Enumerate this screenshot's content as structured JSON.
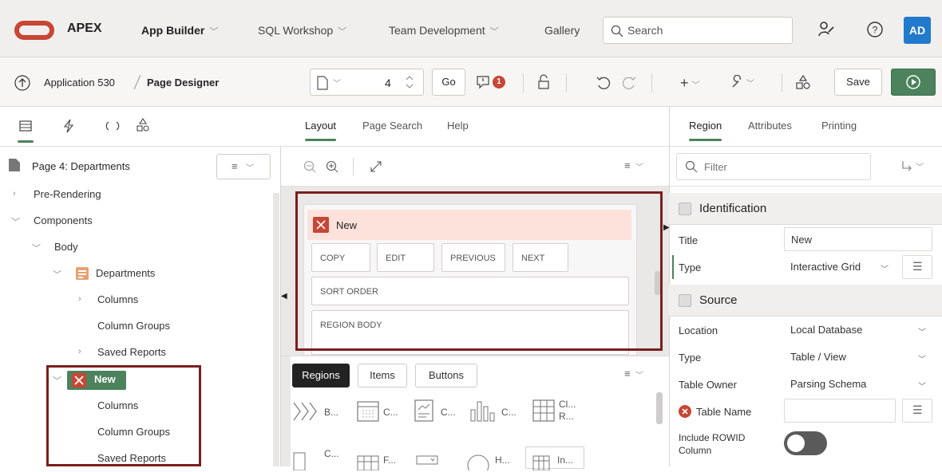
{
  "topnav": {
    "brand": "APEX",
    "items": [
      "App Builder",
      "SQL Workshop",
      "Team Development",
      "Gallery"
    ],
    "search_placeholder": "Search",
    "avatar": "AD"
  },
  "toolbar": {
    "breadcrumb_app": "Application 530",
    "breadcrumb_page": "Page Designer",
    "page_number": "4",
    "go_label": "Go",
    "issues_count": "1",
    "save_label": "Save"
  },
  "left": {
    "page_title": "Page 4: Departments",
    "tree": {
      "pre_rendering": "Pre-Rendering",
      "components": "Components",
      "body": "Body",
      "departments": "Departments",
      "columns": "Columns",
      "column_groups": "Column Groups",
      "saved_reports": "Saved Reports",
      "new": "New",
      "new_columns": "Columns",
      "new_column_groups": "Column Groups",
      "new_saved_reports": "Saved Reports"
    }
  },
  "middle": {
    "tabs": [
      "Layout",
      "Page Search",
      "Help"
    ],
    "region_title": "New",
    "buttons": [
      "COPY",
      "EDIT",
      "PREVIOUS",
      "NEXT"
    ],
    "sort_order": "SORT ORDER",
    "region_body": "REGION BODY",
    "gallery_tabs": [
      "Regions",
      "Items",
      "Buttons"
    ],
    "gallery_row1": [
      "B...",
      "C...",
      "C...",
      "C...",
      "Cl...",
      "R..."
    ],
    "gallery_row2": [
      "C...",
      "F...",
      "H...",
      "In..."
    ]
  },
  "right": {
    "tabs": [
      "Region",
      "Attributes",
      "Printing"
    ],
    "filter_placeholder": "Filter",
    "identification": {
      "header": "Identification",
      "title_label": "Title",
      "title_value": "New",
      "type_label": "Type",
      "type_value": "Interactive Grid"
    },
    "source": {
      "header": "Source",
      "location_label": "Location",
      "location_value": "Local Database",
      "type_label": "Type",
      "type_value": "Table / View",
      "owner_label": "Table Owner",
      "owner_value": "Parsing Schema",
      "table_label": "Table Name",
      "rowid_label1": "Include ROWID",
      "rowid_label2": "Column"
    }
  },
  "colors": {
    "accent_green": "#4c825c",
    "error_red": "#c74634",
    "highlight_border": "#7c1e1e",
    "avatar_blue": "#227acc"
  }
}
